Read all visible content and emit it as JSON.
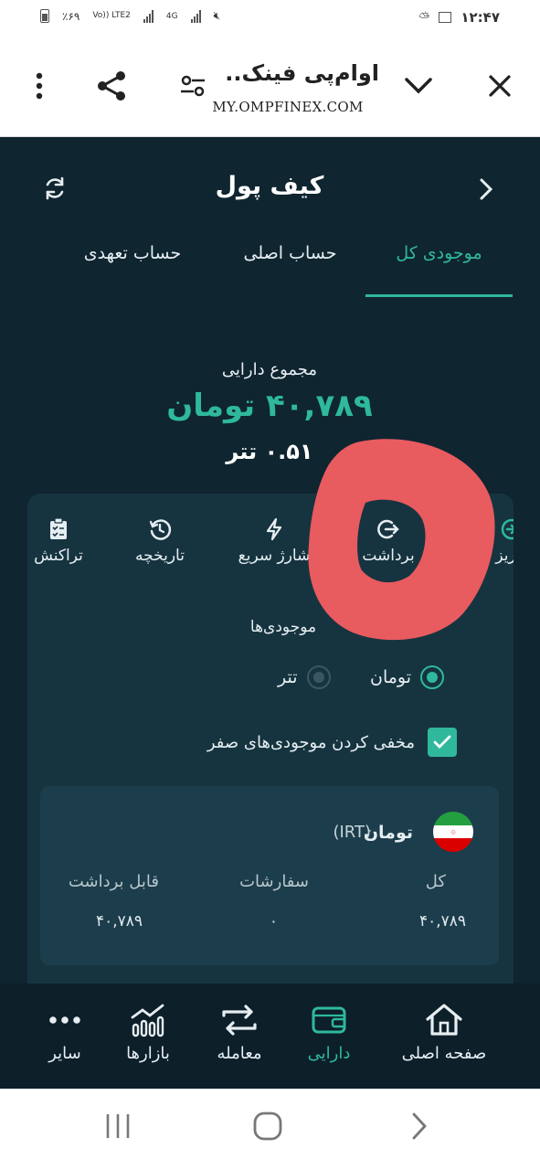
{
  "status_bar": {
    "battery_percent": "٪۶۹",
    "network_1": "Vo)) LTE2",
    "network_2": "4G",
    "time": "۱۲:۴۷"
  },
  "browser": {
    "site_title": "اوام‌پی فینک..",
    "site_url": "MY.OMPFINEX.COM",
    "icons": [
      "more-vert-icon",
      "share-icon",
      "tune-icon",
      "chevron-down-icon",
      "close-icon"
    ]
  },
  "header": {
    "title": "کیف پول"
  },
  "tabs": [
    {
      "label": "موجودی کل",
      "active": true
    },
    {
      "label": "حساب اصلی",
      "active": false
    },
    {
      "label": "حساب تعهدی",
      "active": false
    }
  ],
  "summary": {
    "label": "مجموع دارایی",
    "toman": "۴۰,۷۸۹ تومان",
    "usdt": "۰.۵۱ تتر"
  },
  "actions": [
    {
      "label": "واریز",
      "icon": "deposit-icon"
    },
    {
      "label": "برداشت",
      "icon": "withdraw-icon"
    },
    {
      "label": "شارژ سریع",
      "icon": "lightning-icon"
    },
    {
      "label": "تاریخچه",
      "icon": "history-icon"
    },
    {
      "label": "تراکنش",
      "icon": "clipboard-icon"
    }
  ],
  "balances": {
    "label": "موجودی‌ها",
    "options": [
      {
        "label": "تومان",
        "selected": true
      },
      {
        "label": "تتر",
        "selected": false
      }
    ],
    "hide_zero_label": "مخفی کردن موجودی‌های صفر",
    "hide_zero_checked": true
  },
  "asset": {
    "name": "تومان",
    "code": "(IRT)",
    "columns": [
      {
        "header": "کل",
        "value": "۴۰,۷۸۹"
      },
      {
        "header": "سفارشات",
        "value": "۰"
      },
      {
        "header": "قابل برداشت",
        "value": "۴۰,۷۸۹"
      }
    ]
  },
  "bottom_nav": [
    {
      "label": "صفحه اصلی",
      "icon": "home-icon",
      "active": false
    },
    {
      "label": "دارایی",
      "icon": "wallet-icon",
      "active": true
    },
    {
      "label": "معامله",
      "icon": "swap-icon",
      "active": false
    },
    {
      "label": "بازارها",
      "icon": "market-icon",
      "active": false
    },
    {
      "label": "سایر",
      "icon": "more-horiz-icon",
      "active": false
    }
  ],
  "colors": {
    "background": "#0f2530",
    "accent": "#2fb89c",
    "card": "#163440",
    "annotation": "#e85b5f"
  }
}
